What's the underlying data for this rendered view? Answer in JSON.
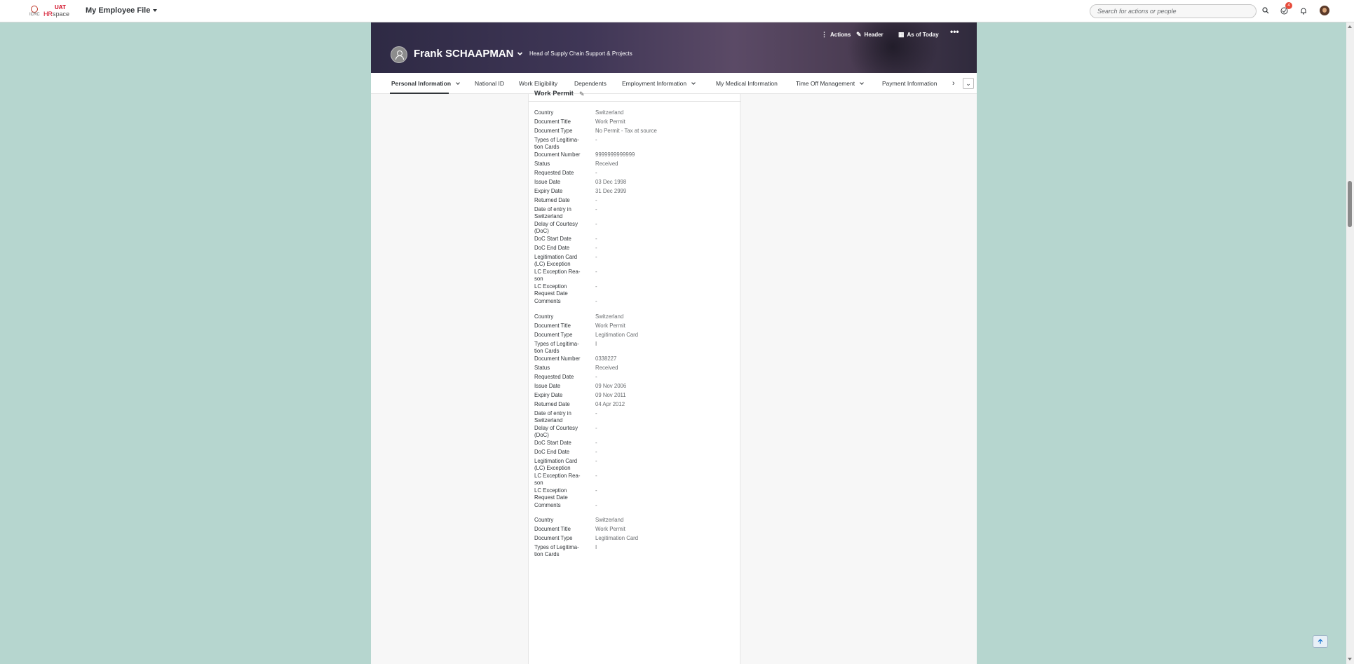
{
  "shell": {
    "logo": {
      "org": "ICRC",
      "env": "UAT",
      "brand_hr": "HR",
      "brand_space": "space"
    },
    "app_title": "My Employee File",
    "search_placeholder": "Search for actions or people",
    "notification_count": "4"
  },
  "header": {
    "name": "Frank SCHAAPMAN",
    "job_title": "Head of Supply Chain Support & Projects",
    "actions_label": "Actions",
    "header_label": "Header",
    "as_of_label": "As of Today"
  },
  "tabs": [
    {
      "label": "Personal Information",
      "has_menu": true
    },
    {
      "label": "National ID"
    },
    {
      "label": "Work Eligibility"
    },
    {
      "label": "Dependents"
    },
    {
      "label": "Employment Information",
      "has_menu": true
    },
    {
      "label": "My Medical Information"
    },
    {
      "label": "Time Off Management",
      "has_menu": true
    },
    {
      "label": "Payment Information"
    }
  ],
  "section_title": "Work Permit",
  "records": [
    [
      {
        "label": "Country",
        "value": "Switzerland"
      },
      {
        "label": "Document Title",
        "value": "Work Permit"
      },
      {
        "label": "Document Type",
        "value": "No Permit - Tax at source"
      },
      {
        "label": "Types of Legitima-\ntion Cards",
        "value": "-"
      },
      {
        "label": "Document Number",
        "value": "9999999999999"
      },
      {
        "label": "Status",
        "value": "Received"
      },
      {
        "label": "Requested Date",
        "value": "-"
      },
      {
        "label": "Issue Date",
        "value": "03 Dec 1998"
      },
      {
        "label": "Expiry Date",
        "value": "31 Dec 2999"
      },
      {
        "label": "Returned Date",
        "value": "-"
      },
      {
        "label": "Date of entry in\nSwitzerland",
        "value": "-"
      },
      {
        "label": "Delay of Courtesy\n(DoC)",
        "value": "-"
      },
      {
        "label": "DoC Start Date",
        "value": "-"
      },
      {
        "label": "DoC End Date",
        "value": "-"
      },
      {
        "label": "Legitimation Card\n(LC) Exception",
        "value": "-"
      },
      {
        "label": "LC Exception Rea-\nson",
        "value": "-"
      },
      {
        "label": "LC Exception\nRequest Date",
        "value": "-"
      },
      {
        "label": "Comments",
        "value": "-"
      }
    ],
    [
      {
        "label": "Country",
        "value": "Switzerland"
      },
      {
        "label": "Document Title",
        "value": "Work Permit"
      },
      {
        "label": "Document Type",
        "value": "Legitimation Card"
      },
      {
        "label": "Types of Legitima-\ntion Cards",
        "value": "I"
      },
      {
        "label": "Document Number",
        "value": "0338227"
      },
      {
        "label": "Status",
        "value": "Received"
      },
      {
        "label": "Requested Date",
        "value": "-"
      },
      {
        "label": "Issue Date",
        "value": "09 Nov 2006"
      },
      {
        "label": "Expiry Date",
        "value": "09 Nov 2011"
      },
      {
        "label": "Returned Date",
        "value": "04 Apr 2012"
      },
      {
        "label": "Date of entry in\nSwitzerland",
        "value": "-"
      },
      {
        "label": "Delay of Courtesy\n(DoC)",
        "value": "-"
      },
      {
        "label": "DoC Start Date",
        "value": "-"
      },
      {
        "label": "DoC End Date",
        "value": "-"
      },
      {
        "label": "Legitimation Card\n(LC) Exception",
        "value": "-"
      },
      {
        "label": "LC Exception Rea-\nson",
        "value": "-"
      },
      {
        "label": "LC Exception\nRequest Date",
        "value": "-"
      },
      {
        "label": "Comments",
        "value": "-"
      }
    ],
    [
      {
        "label": "Country",
        "value": "Switzerland"
      },
      {
        "label": "Document Title",
        "value": "Work Permit"
      },
      {
        "label": "Document Type",
        "value": "Legitimation Card"
      },
      {
        "label": "Types of Legitima-\ntion Cards",
        "value": "I"
      }
    ]
  ],
  "colors": {
    "background": "#b6d6cf",
    "accent_red": "#d0021b",
    "text": "#32363a",
    "muted": "#6a6d70"
  }
}
